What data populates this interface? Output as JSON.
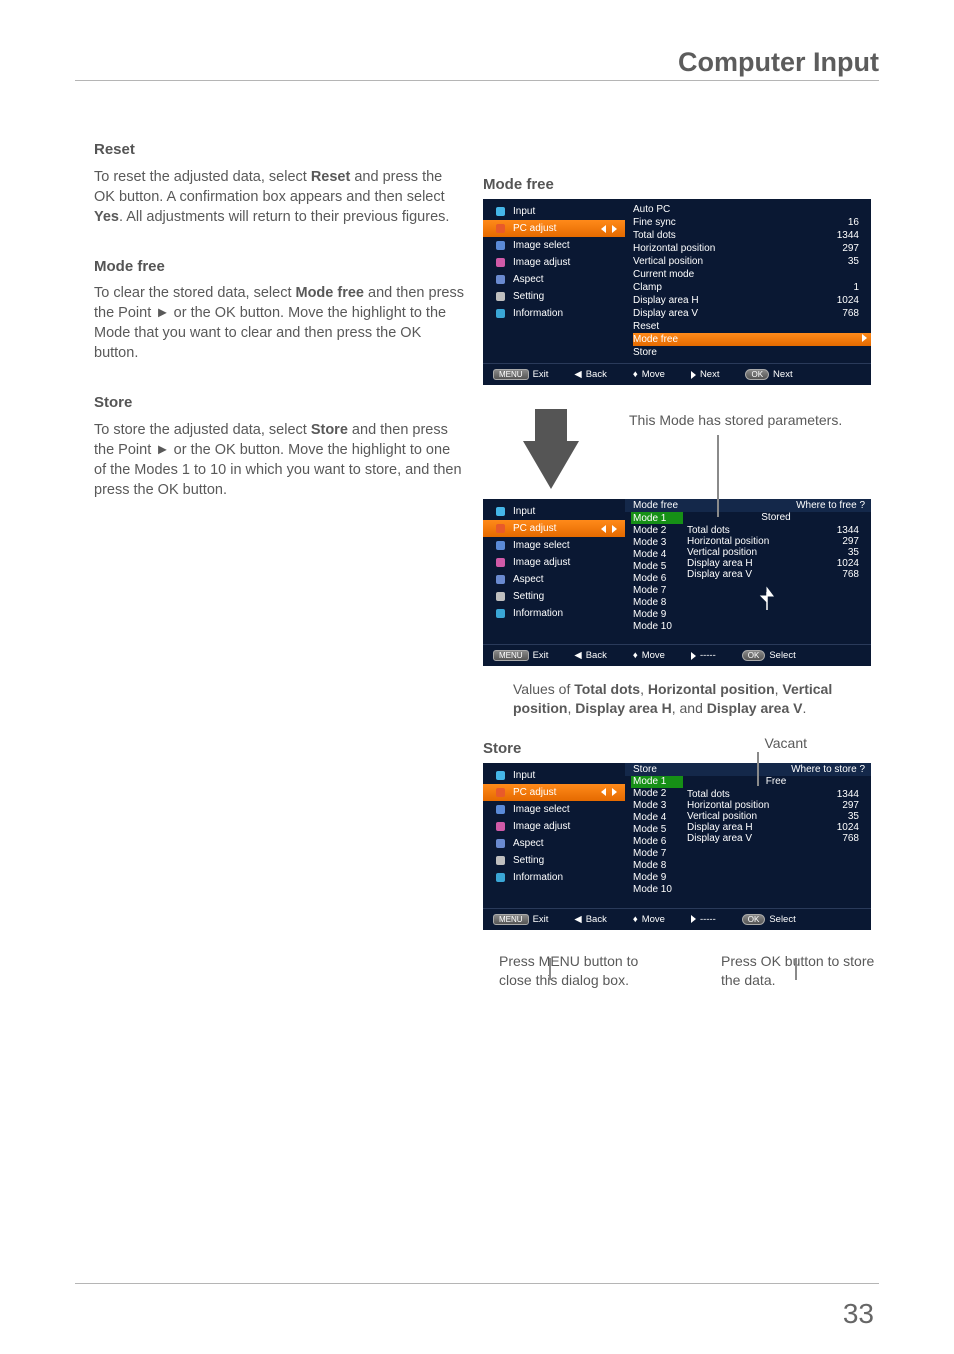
{
  "header": {
    "title": "Computer Input"
  },
  "page_number": "33",
  "left": {
    "reset": {
      "heading": "Reset",
      "body_parts": [
        "To reset the adjusted data, select ",
        "Reset",
        " and press the OK button. A confirmation box appears and then select ",
        "Yes",
        ". All adjustments will return to their previous figures."
      ]
    },
    "modefree": {
      "heading": "Mode free",
      "body_parts": [
        "To clear the stored data, select ",
        "Mode free",
        " and then press the Point ► or the OK button. Move the highlight to the Mode that you want to clear and then press the OK button."
      ]
    },
    "store": {
      "heading": "Store",
      "body_parts": [
        "To store the adjusted data, select ",
        "Store",
        " and then press the Point ► or the OK button. Move the highlight to one of the Modes 1 to 10 in which you want to store, and then press the OK button."
      ]
    }
  },
  "right": {
    "panel1_title": "Mode free",
    "stored_callout": "This Mode has stored parameters.",
    "values_caption_parts": [
      "Values of ",
      "Total dots",
      ", ",
      "Horizontal position",
      ", ",
      "Vertical position",
      ", ",
      "Display area H",
      ", and ",
      "Display area V",
      "."
    ],
    "panel3_title": "Store",
    "vacant_label": "Vacant",
    "press_menu": "Press MENU button to close this dialog box.",
    "press_ok": "Press OK button to store the data."
  },
  "sidebar_items": [
    {
      "label": "Input",
      "icon": "input",
      "color": "#45b6e8"
    },
    {
      "label": "PC adjust",
      "icon": "tool",
      "color": "#e85a2a"
    },
    {
      "label": "Image select",
      "icon": "bars",
      "color": "#5a8ad8"
    },
    {
      "label": "Image adjust",
      "icon": "sliders",
      "color": "#d05aa8"
    },
    {
      "label": "Aspect",
      "icon": "rect",
      "color": "#6a8ad0"
    },
    {
      "label": "Setting",
      "icon": "gear",
      "color": "#bfbfbf"
    },
    {
      "label": "Information",
      "icon": "info",
      "color": "#3aa6d6"
    }
  ],
  "pc_adjust_list": [
    {
      "label": "Auto PC",
      "value": ""
    },
    {
      "label": "Fine sync",
      "value": "16"
    },
    {
      "label": "Total dots",
      "value": "1344"
    },
    {
      "label": "Horizontal position",
      "value": "297"
    },
    {
      "label": "Vertical position",
      "value": "35"
    },
    {
      "label": "Current mode",
      "value": ""
    },
    {
      "label": "Clamp",
      "value": "1"
    },
    {
      "label": "Display area H",
      "value": "1024"
    },
    {
      "label": "Display area V",
      "value": "768"
    },
    {
      "label": "Reset",
      "value": ""
    },
    {
      "label": "Mode free",
      "value": "",
      "selected": true
    },
    {
      "label": "Store",
      "value": ""
    }
  ],
  "footer_labels": {
    "exit": "Exit",
    "back": "Back",
    "move": "Move",
    "next": "Next",
    "ok_next": "Next",
    "ok_select": "Select",
    "dash": "-----"
  },
  "footer_keys": {
    "menu": "MENU",
    "ok": "OK"
  },
  "where_to": {
    "free": "Where to free ?",
    "store": "Where to store ?"
  },
  "status_words": {
    "stored": "Stored",
    "free": "Free"
  },
  "modes": [
    "Mode 1",
    "Mode 2",
    "Mode 3",
    "Mode 4",
    "Mode 5",
    "Mode 6",
    "Mode 7",
    "Mode 8",
    "Mode 9",
    "Mode 10"
  ],
  "panel_header": {
    "modefree": "Mode free",
    "store": "Store"
  },
  "data_rows": [
    {
      "label": "Total dots",
      "value": "1344"
    },
    {
      "label": "Horizontal position",
      "value": "297"
    },
    {
      "label": "Vertical position",
      "value": "35"
    },
    {
      "label": "Display area H",
      "value": "1024"
    },
    {
      "label": "Display area V",
      "value": "768"
    }
  ]
}
